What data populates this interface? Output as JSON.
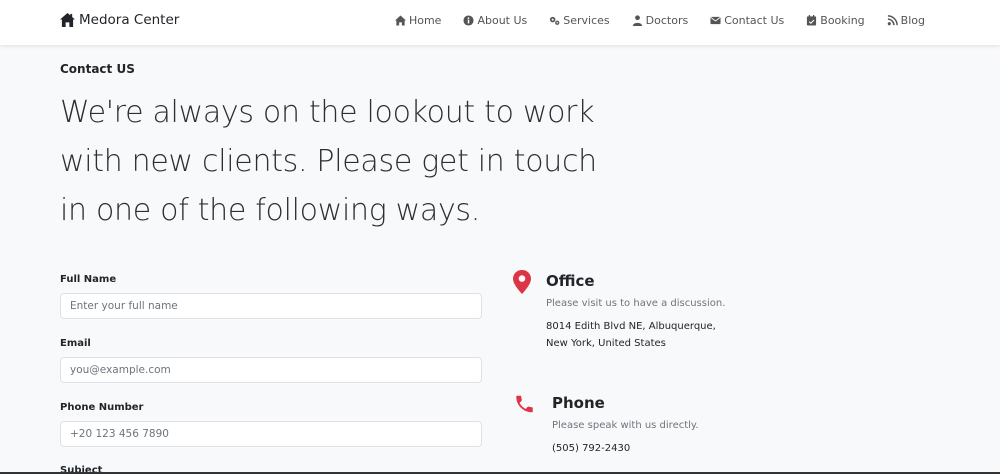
{
  "brand": {
    "name": "Medora Center"
  },
  "nav": {
    "items": [
      {
        "label": "Home"
      },
      {
        "label": "About Us"
      },
      {
        "label": "Services"
      },
      {
        "label": "Doctors"
      },
      {
        "label": "Contact Us"
      },
      {
        "label": "Booking"
      },
      {
        "label": "Blog"
      }
    ]
  },
  "hero": {
    "eyebrow": "Contact US",
    "headline": "We're always on the lookout to work with new clients. Please get in touch in one of the following ways."
  },
  "form": {
    "full_name": {
      "label": "Full Name",
      "placeholder": "Enter your full name"
    },
    "email": {
      "label": "Email",
      "placeholder": "you@example.com"
    },
    "phone": {
      "label": "Phone Number",
      "placeholder": "+20 123 456 7890"
    },
    "subject": {
      "label": "Subject"
    }
  },
  "office": {
    "title": "Office",
    "subtitle": "Please visit us to have a discussion.",
    "address_line1": "8014 Edith Blvd NE, Albuquerque,",
    "address_line2": "New York, United States"
  },
  "phone_info": {
    "title": "Phone",
    "subtitle": "Please speak with us directly.",
    "number": "(505) 792-2430"
  },
  "colors": {
    "accent": "#dc3545",
    "background": "#f8f9fa",
    "navbar": "#ffffff"
  }
}
